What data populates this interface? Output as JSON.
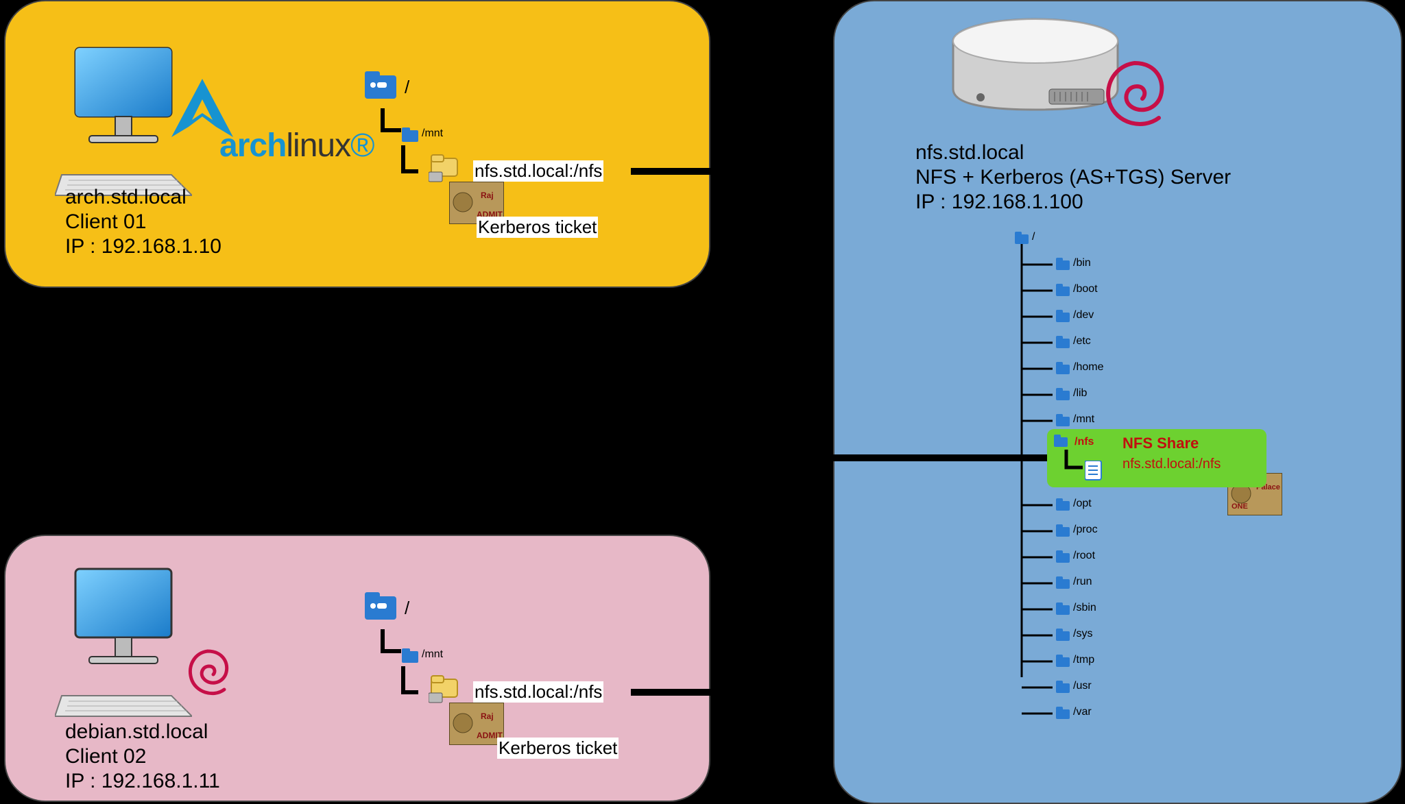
{
  "client1": {
    "hostname": "arch.std.local",
    "role": "Client 01",
    "ip": "IP : 192.168.1.10",
    "logo_arch": "arch",
    "logo_linux": "linux",
    "root": "/",
    "mnt": "/mnt",
    "mount_target": "nfs.std.local:/nfs",
    "ticket": "Kerberos ticket"
  },
  "client2": {
    "hostname": "debian.std.local",
    "role": "Client 02",
    "ip": "IP : 192.168.1.11",
    "root": "/",
    "mnt": "/mnt",
    "mount_target": "nfs.std.local:/nfs",
    "ticket": "Kerberos ticket"
  },
  "server": {
    "hostname": "nfs.std.local",
    "role": "NFS + Kerberos (AS+TGS) Server",
    "ip": "IP : 192.168.1.100",
    "fs_root": "/",
    "fs": [
      "/bin",
      "/boot",
      "/dev",
      "/etc",
      "/home",
      "/lib",
      "/mnt",
      "/nfs",
      "/opt",
      "/proc",
      "/root",
      "/run",
      "/sbin",
      "/sys",
      "/tmp",
      "/usr",
      "/var"
    ],
    "share_label": "/nfs",
    "share_title": "NFS Share",
    "share_path": "nfs.std.local:/nfs"
  }
}
